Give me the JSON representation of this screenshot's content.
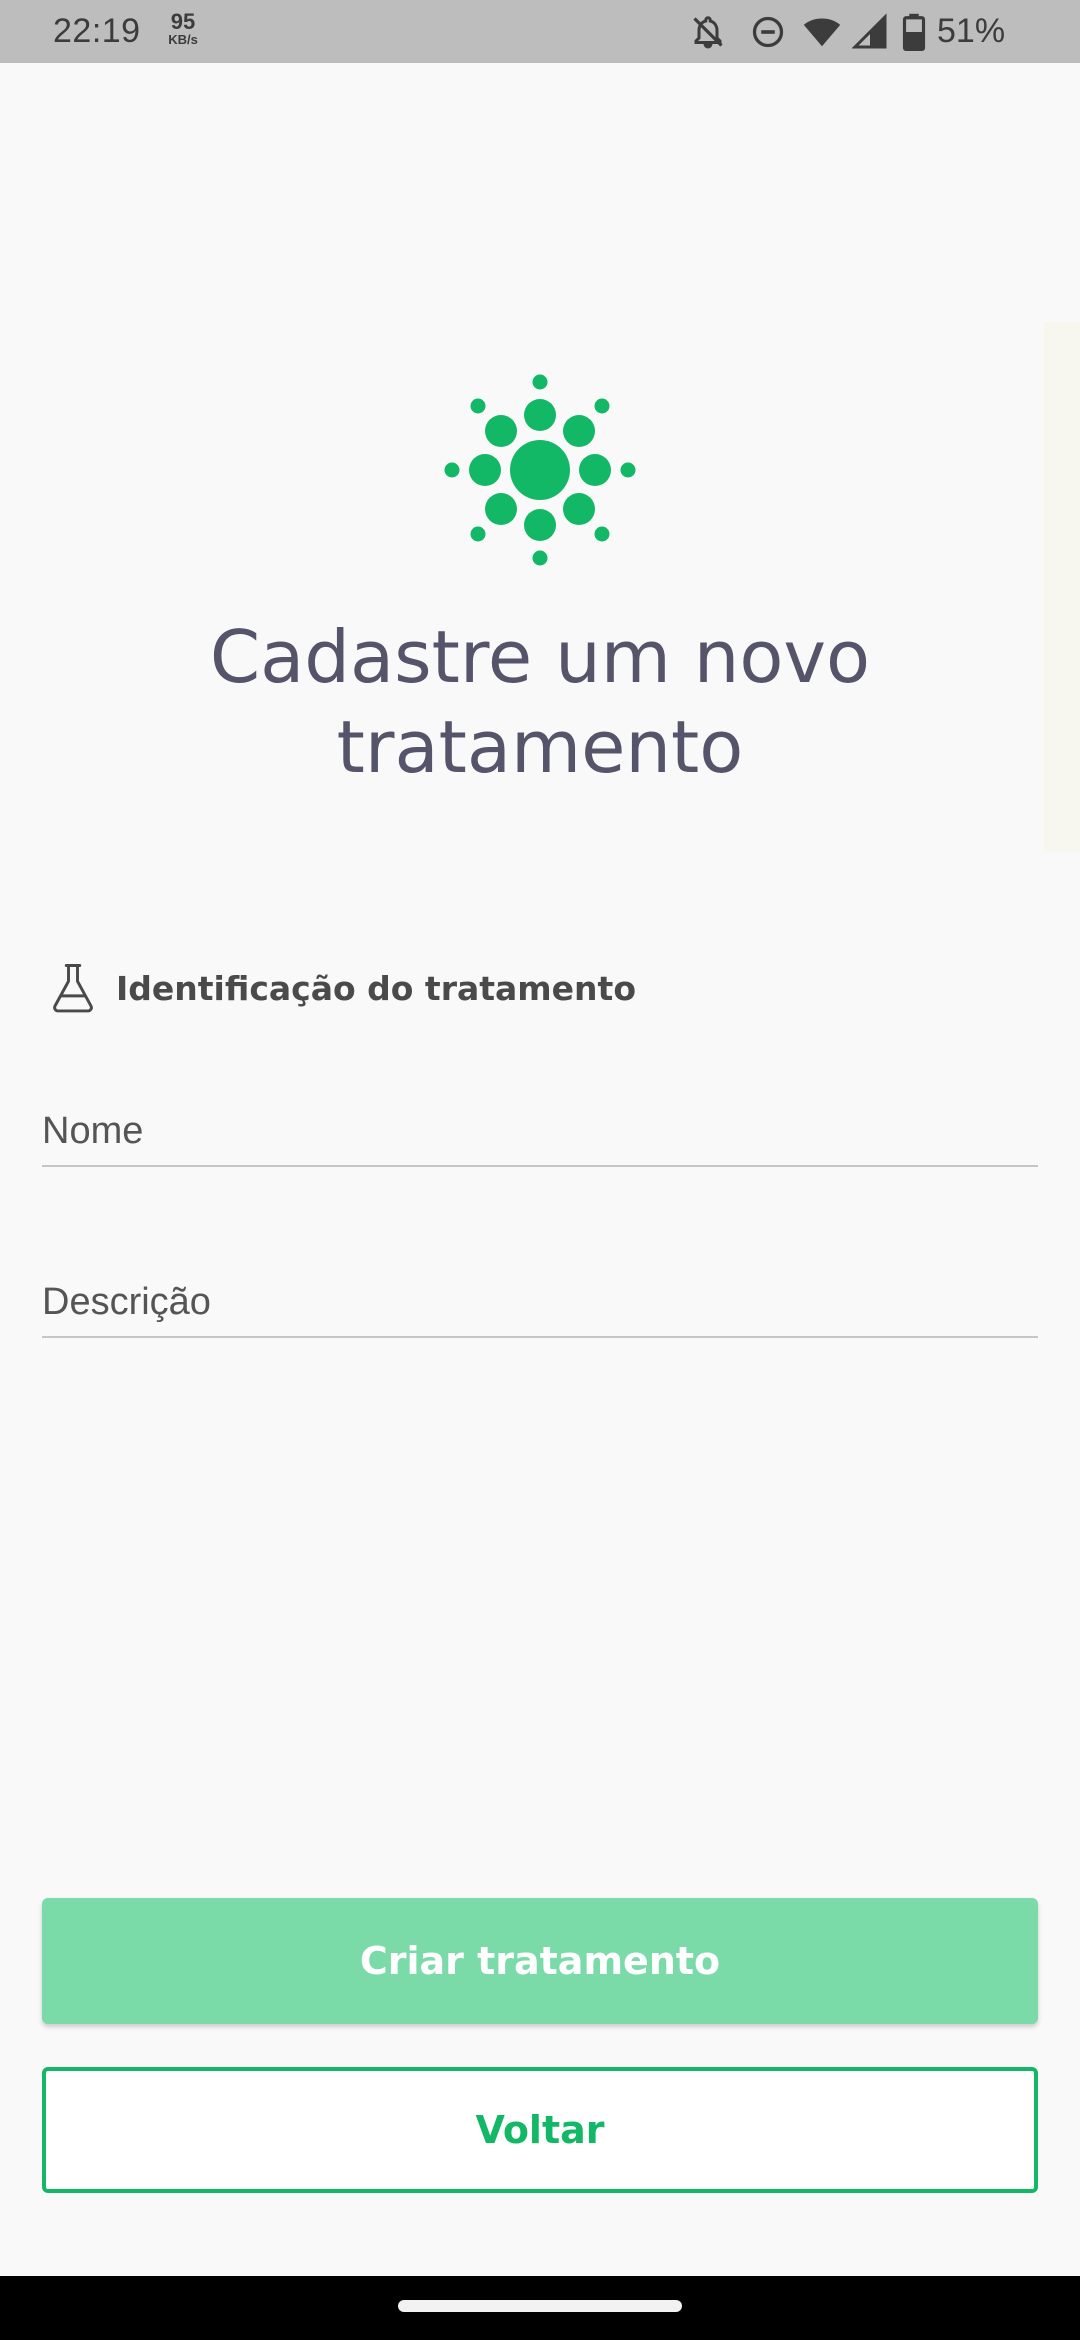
{
  "status_bar": {
    "time": "22:19",
    "net_speed_value": "95",
    "net_speed_unit": "KB/s",
    "battery_percent": "51%",
    "icons": [
      "notifications-off-icon",
      "do-not-disturb-icon",
      "wifi-icon",
      "cell-signal-icon",
      "battery-icon"
    ]
  },
  "logo": {
    "icon": "green-dots-sun-logo",
    "color": "#13b866"
  },
  "title": "Cadastre um novo tratamento",
  "section": {
    "icon": "flask-icon",
    "label": "Identificação do tratamento"
  },
  "form": {
    "name_placeholder": "Nome",
    "name_value": "",
    "description_placeholder": "Descrição",
    "description_value": ""
  },
  "buttons": {
    "create_label": "Criar tratamento",
    "back_label": "Voltar"
  },
  "colors": {
    "accent": "#13b866",
    "primary_button_disabled": "#7adba9",
    "title_text": "#55546a",
    "background": "#f9f9f9"
  }
}
